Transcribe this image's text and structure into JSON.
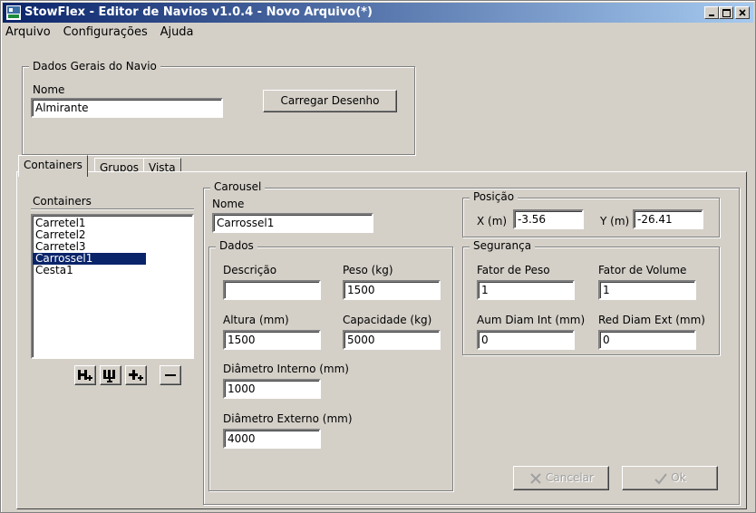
{
  "window": {
    "title": "StowFlex - Editor de Navios v1.0.4 - Novo Arquivo(*)"
  },
  "menu": [
    {
      "label": "Arquivo"
    },
    {
      "label": "Configurações"
    },
    {
      "label": "Ajuda"
    }
  ],
  "dados_gerais": {
    "legend": "Dados Gerais do Navio",
    "nome_label": "Nome",
    "nome_value": "Almirante",
    "carregar_label": "Carregar Desenho"
  },
  "tabs": [
    {
      "label": "Containers",
      "active": true
    },
    {
      "label": "Grupos",
      "active": false
    },
    {
      "label": "Vista",
      "active": false
    }
  ],
  "containers": {
    "header": "Containers",
    "items": [
      "Carretel1",
      "Carretel2",
      "Carretel3",
      "Carrossel1",
      "Cesta1"
    ],
    "selected_index": 3,
    "toolbar_icons": [
      "add-container-icon",
      "add-container-below-icon",
      "add-container-right-icon",
      "remove-icon"
    ]
  },
  "carousel": {
    "legend": "Carousel",
    "nome_label": "Nome",
    "nome_value": "Carrossel1",
    "dados": {
      "legend": "Dados",
      "descricao_label": "Descrição",
      "descricao_value": "",
      "peso_label": "Peso (kg)",
      "peso_value": "1500",
      "altura_label": "Altura (mm)",
      "altura_value": "1500",
      "capacidade_label": "Capacidade (kg)",
      "capacidade_value": "5000",
      "diam_int_label": "Diâmetro Interno (mm)",
      "diam_int_value": "1000",
      "diam_ext_label": "Diâmetro Externo (mm)",
      "diam_ext_value": "4000"
    },
    "posicao": {
      "legend": "Posição",
      "x_label": "X (m)",
      "x_value": "-3.56",
      "y_label": "Y (m)",
      "y_value": "-26.41"
    },
    "seguranca": {
      "legend": "Segurança",
      "fator_peso_label": "Fator de Peso",
      "fator_peso_value": "1",
      "fator_volume_label": "Fator de Volume",
      "fator_volume_value": "1",
      "aum_diam_label": "Aum Diam Int (mm)",
      "aum_diam_value": "0",
      "red_diam_label": "Red Diam Ext (mm)",
      "red_diam_value": "0"
    }
  },
  "actions": {
    "cancelar_label": "Cancelar",
    "ok_label": "Ok"
  }
}
